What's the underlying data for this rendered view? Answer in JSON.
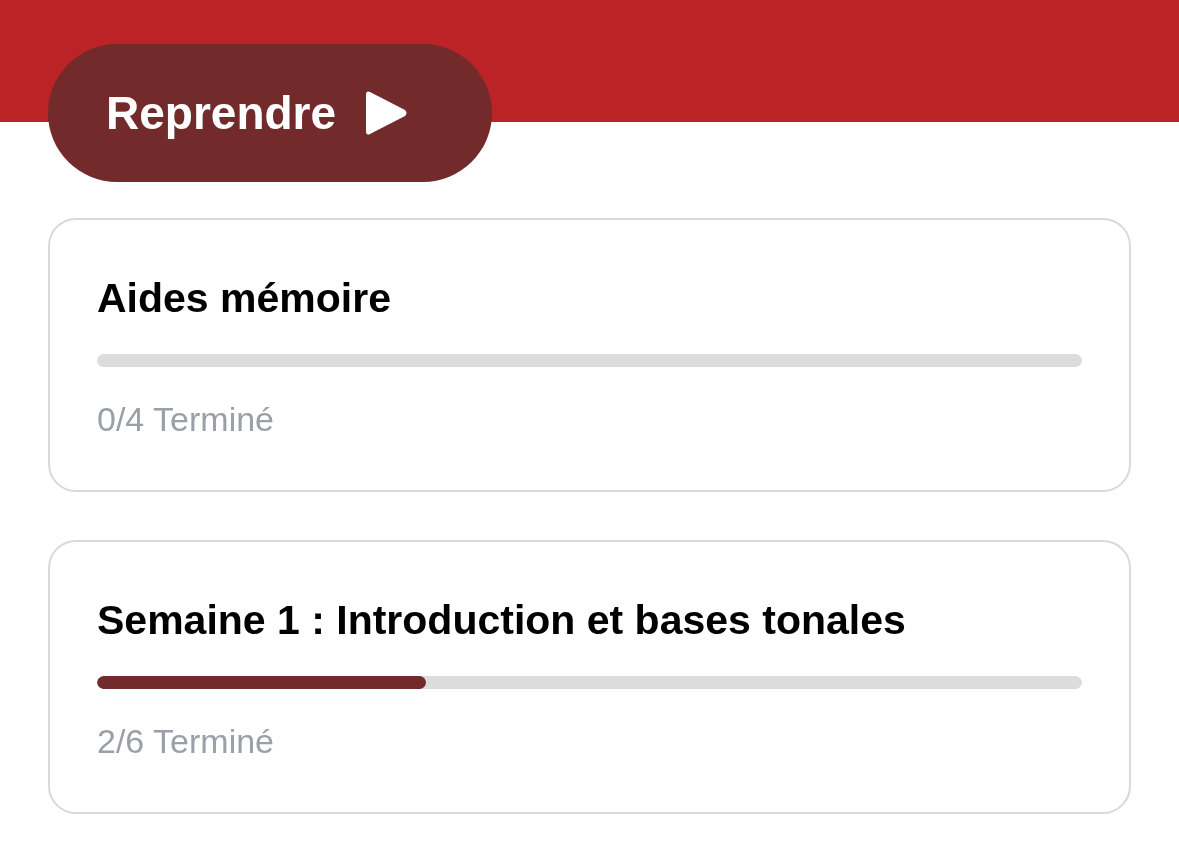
{
  "resume_button": {
    "label": "Reprendre"
  },
  "modules": [
    {
      "title": "Aides mémoire",
      "level": 0,
      "status": "0/4 Terminé"
    },
    {
      "title": "Semaine 1 : Introduction et bases tonales",
      "level": 0.3344,
      "status": "2/6 Terminé"
    }
  ]
}
